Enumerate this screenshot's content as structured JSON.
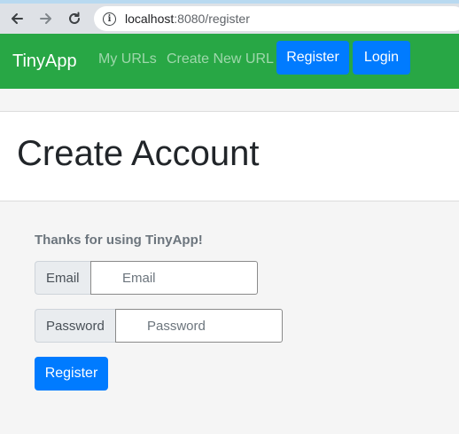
{
  "browser": {
    "url_host": "localhost",
    "url_rest": ":8080/register",
    "icons": [
      "back-arrow-icon",
      "forward-arrow-icon",
      "reload-icon",
      "info-icon"
    ]
  },
  "navbar": {
    "brand": "TinyApp",
    "links": [
      "My URLs",
      "Create New URL"
    ],
    "register_label": "Register",
    "login_label": "Login",
    "color": "#28a745",
    "button_color": "#007bff"
  },
  "header": {
    "title": "Create Account"
  },
  "form": {
    "thanks": "Thanks for using TinyApp!",
    "email_label": "Email",
    "email_placeholder": "Email",
    "password_label": "Password",
    "password_placeholder": "Password",
    "submit_label": "Register"
  }
}
